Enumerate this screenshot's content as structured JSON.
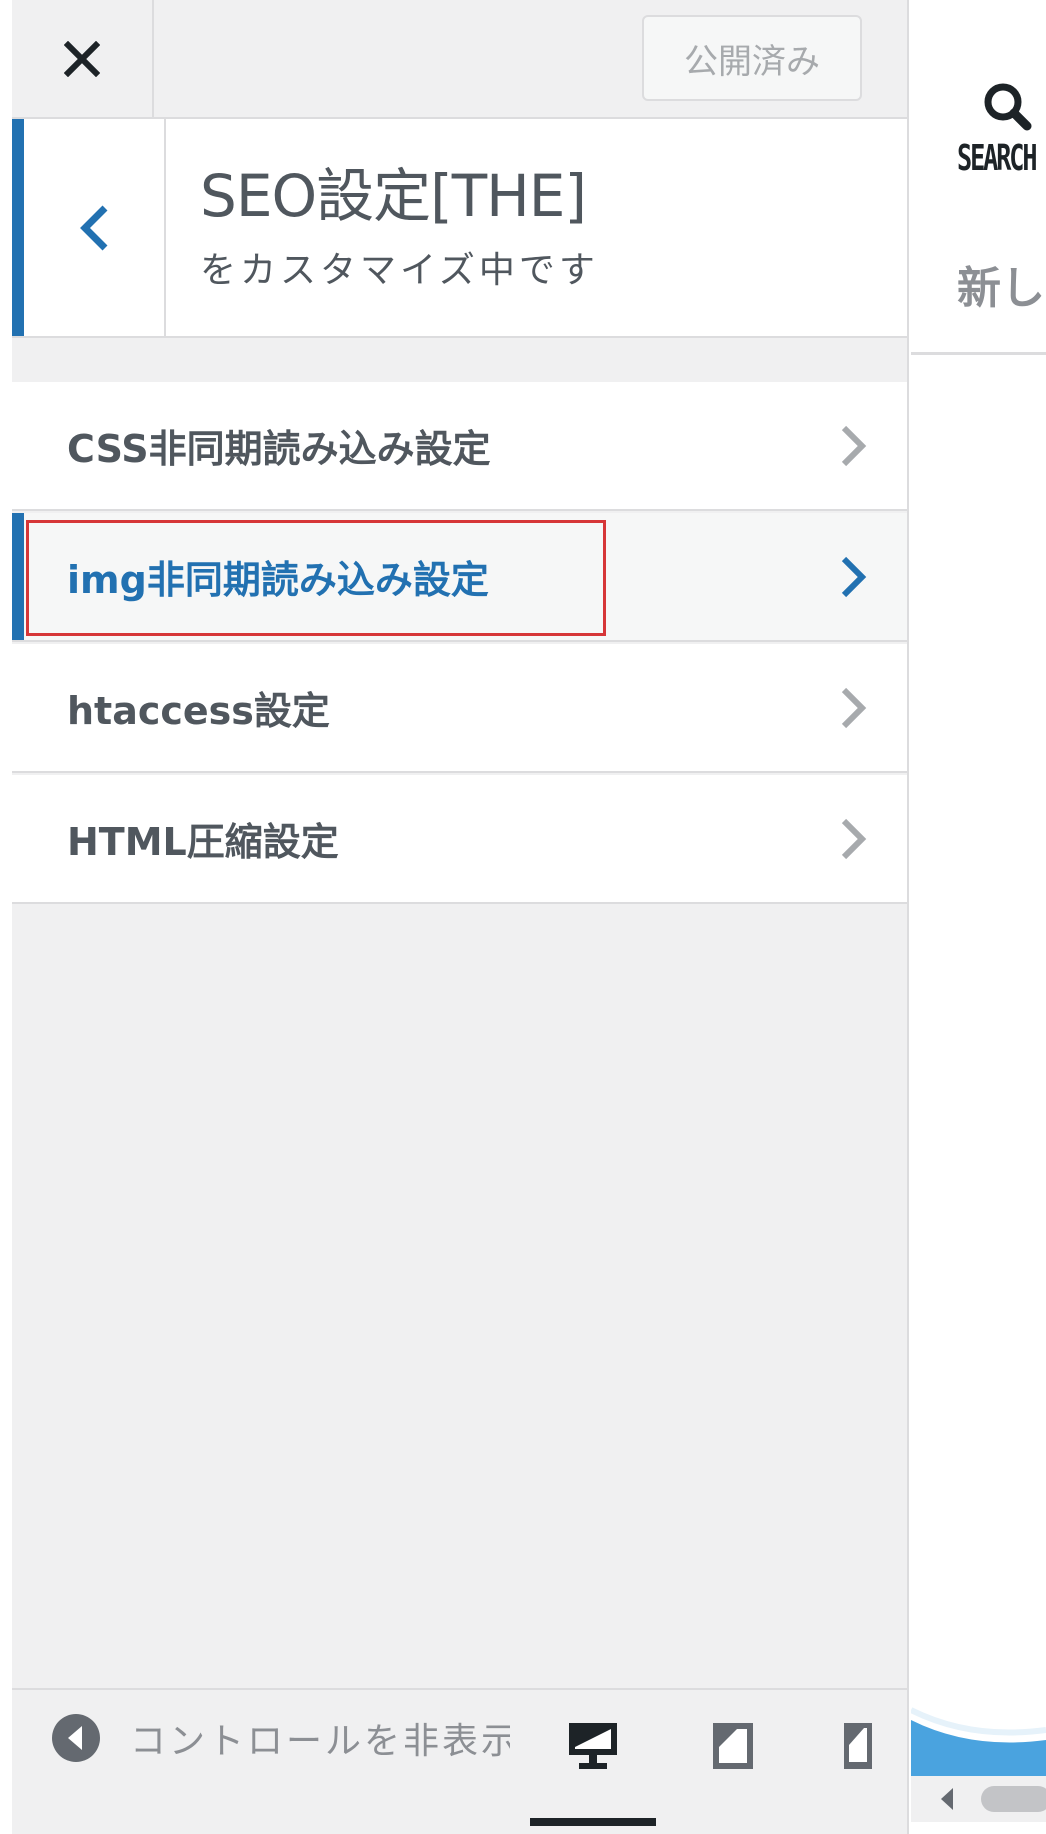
{
  "header": {
    "close_icon": "close-icon",
    "publish_label": "公開済み"
  },
  "section": {
    "back_icon": "chevron-left-icon",
    "title": "SEO設定[THE]",
    "subtitle": "をカスタマイズ中です"
  },
  "menu": {
    "items": [
      {
        "label": "CSS非同期読み込み設定",
        "active": false
      },
      {
        "label": "img非同期読み込み設定",
        "active": true
      },
      {
        "label": "htaccess設定",
        "active": false
      },
      {
        "label": "HTML圧縮設定",
        "active": false
      }
    ]
  },
  "footer": {
    "collapse_label": "コントロールを非表示",
    "devices": [
      "desktop-icon",
      "tablet-icon",
      "mobile-icon"
    ],
    "active_device": "desktop"
  },
  "preview": {
    "search_label": "SEARCH",
    "new_label": "新し"
  },
  "colors": {
    "accent": "#2271b1",
    "highlight": "#d63638",
    "panel_bg": "#f0f0f1"
  }
}
